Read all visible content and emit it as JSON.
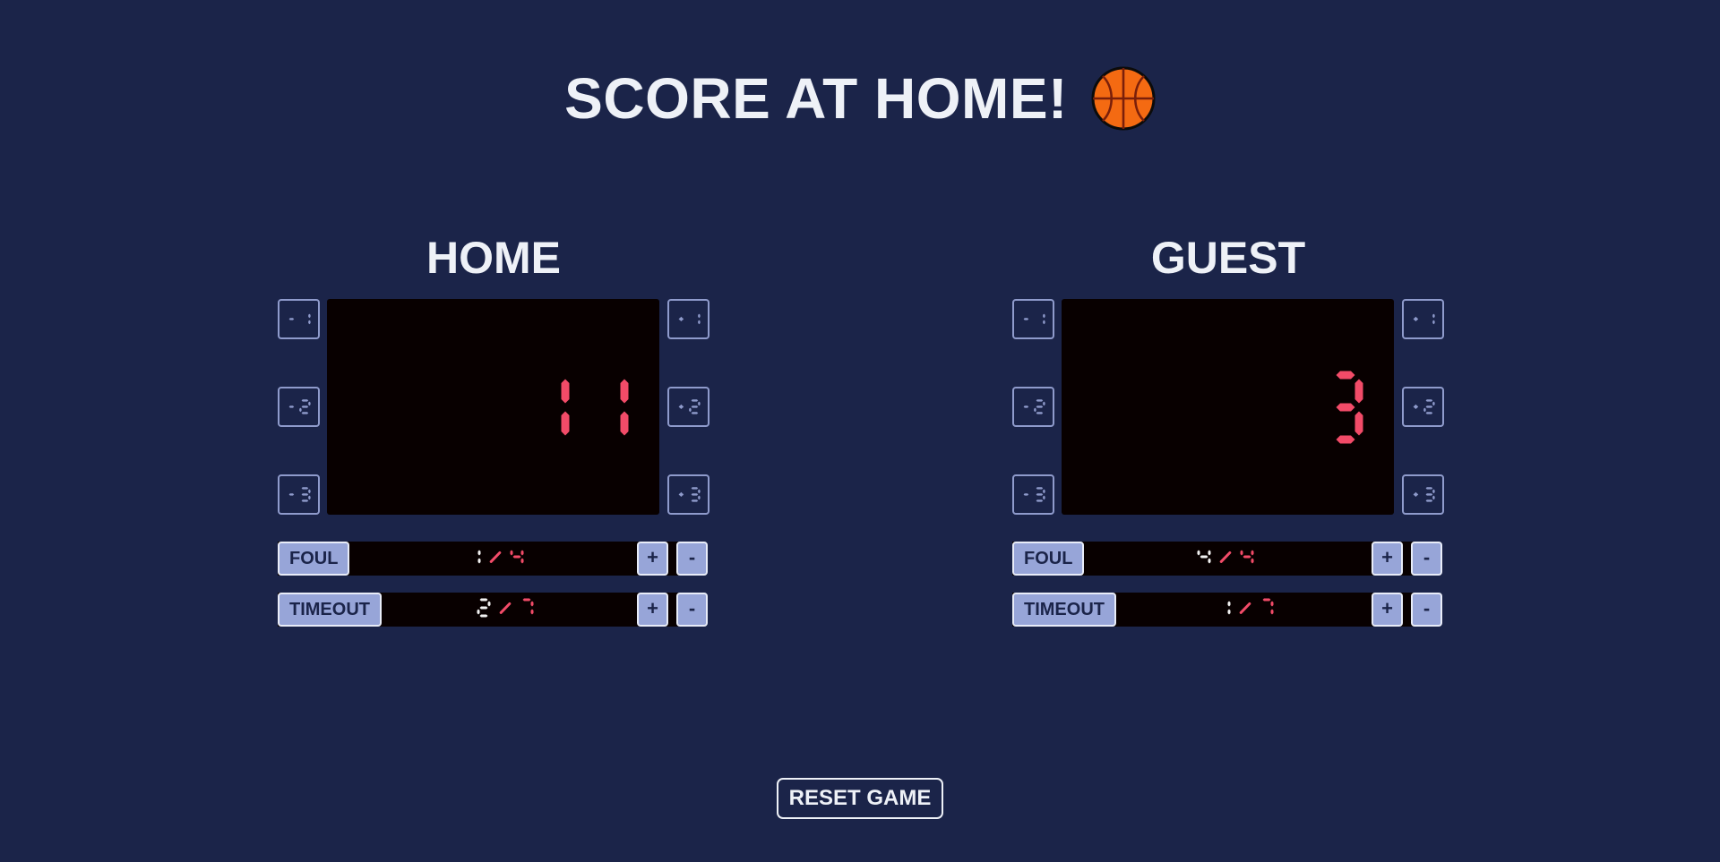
{
  "header": {
    "title": "SCORE AT HOME!",
    "icon": "basketball-icon"
  },
  "home": {
    "name": "HOME",
    "score": "11",
    "minus_buttons": [
      "-1",
      "-2",
      "-3"
    ],
    "plus_buttons": [
      "+1",
      "+2",
      "+3"
    ],
    "foul": {
      "label": "FOUL",
      "value": "1",
      "max": "4"
    },
    "timeout": {
      "label": "TIMEOUT",
      "value": "2",
      "max": "7"
    },
    "plus_label": "+",
    "minus_label": "-"
  },
  "guest": {
    "name": "GUEST",
    "score": "3",
    "minus_buttons": [
      "-1",
      "-2",
      "-3"
    ],
    "plus_buttons": [
      "+1",
      "+2",
      "+3"
    ],
    "foul": {
      "label": "FOUL",
      "value": "4",
      "max": "4"
    },
    "timeout": {
      "label": "TIMEOUT",
      "value": "1",
      "max": "7"
    },
    "plus_label": "+",
    "minus_label": "-"
  },
  "reset_label": "RESET GAME",
  "colors": {
    "background": "#1b2449",
    "display": "#080000",
    "score_led": "#f24b68",
    "current_led": "#f2f2f2",
    "button_fill": "#97a5d8",
    "button_outline": "#8f9bcc"
  }
}
